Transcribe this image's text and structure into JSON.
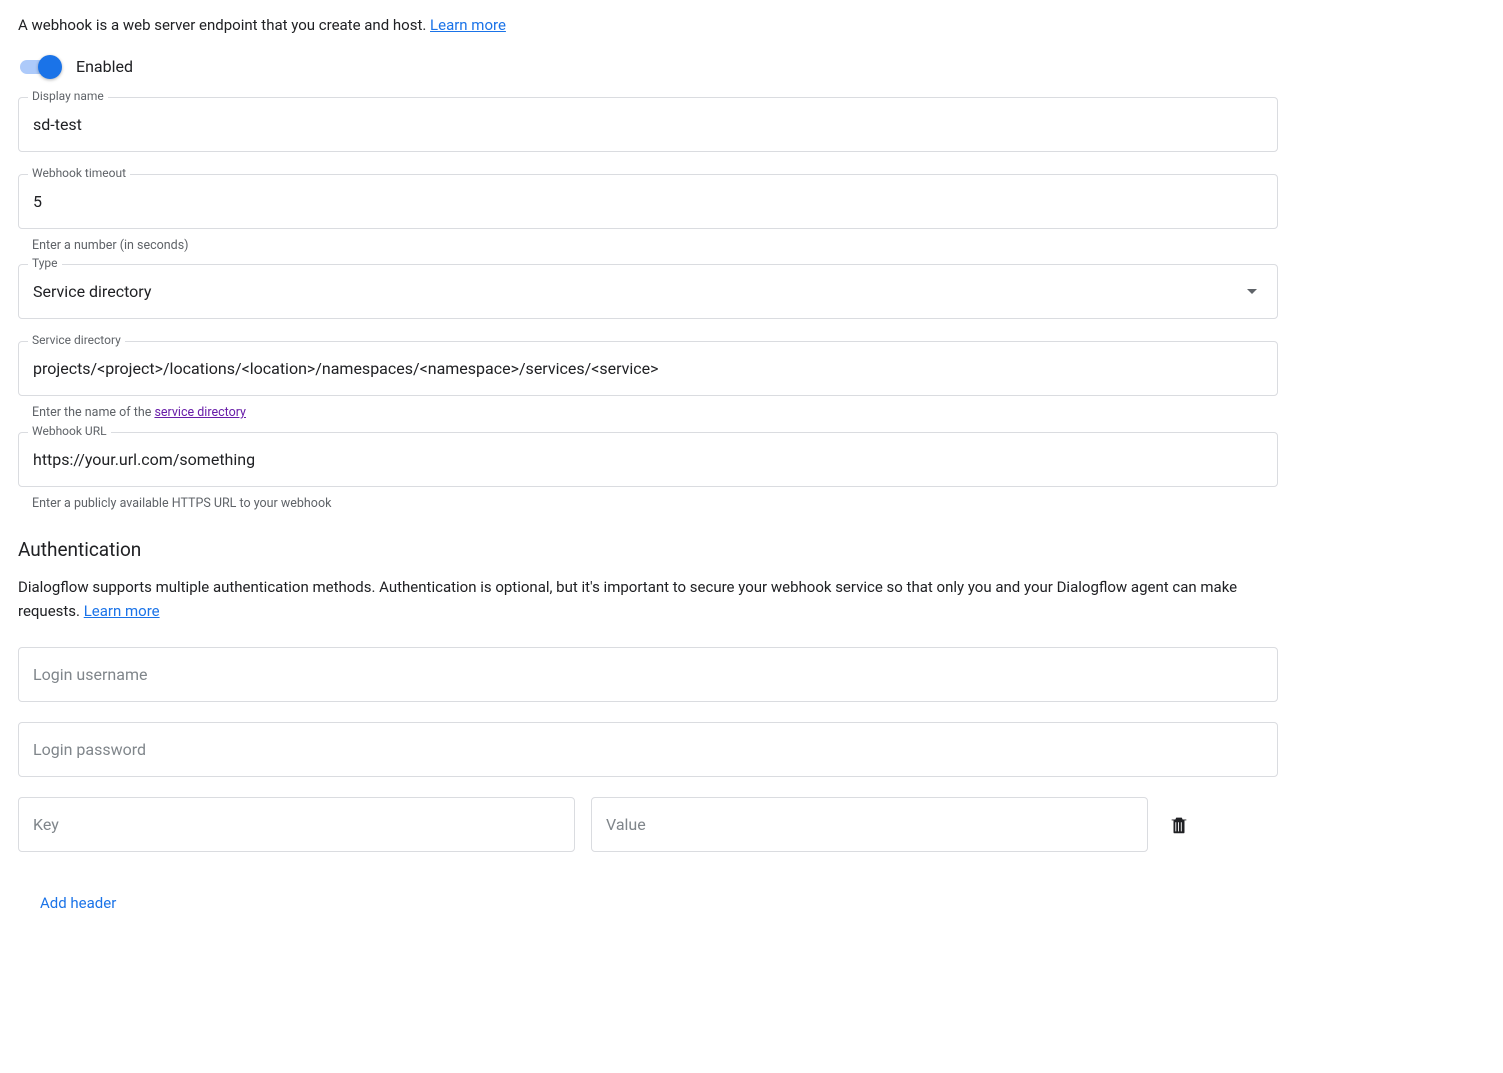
{
  "intro": {
    "text": "A webhook is a web server endpoint that you create and host. ",
    "learn_more": "Learn more"
  },
  "enabled": {
    "label": "Enabled",
    "value": true
  },
  "display_name": {
    "label": "Display name",
    "value": "sd-test"
  },
  "webhook_timeout": {
    "label": "Webhook timeout",
    "value": "5",
    "help": "Enter a number (in seconds)"
  },
  "type": {
    "label": "Type",
    "value": "Service directory"
  },
  "service_directory": {
    "label": "Service directory",
    "value": "projects/<project>/locations/<location>/namespaces/<namespace>/services/<service>",
    "help_prefix": "Enter the name of the ",
    "help_link": "service directory"
  },
  "webhook_url": {
    "label": "Webhook URL",
    "value": "https://your.url.com/something",
    "help": "Enter a publicly available HTTPS URL to your webhook"
  },
  "auth": {
    "title": "Authentication",
    "desc_prefix": "Dialogflow supports multiple authentication methods. Authentication is optional, but it's important to secure your webhook service so that only you and your Dialogflow agent can make requests. ",
    "learn_more": "Learn more",
    "login_username_placeholder": "Login username",
    "login_password_placeholder": "Login password",
    "header_key_placeholder": "Key",
    "header_value_placeholder": "Value",
    "add_header_label": "Add header"
  }
}
